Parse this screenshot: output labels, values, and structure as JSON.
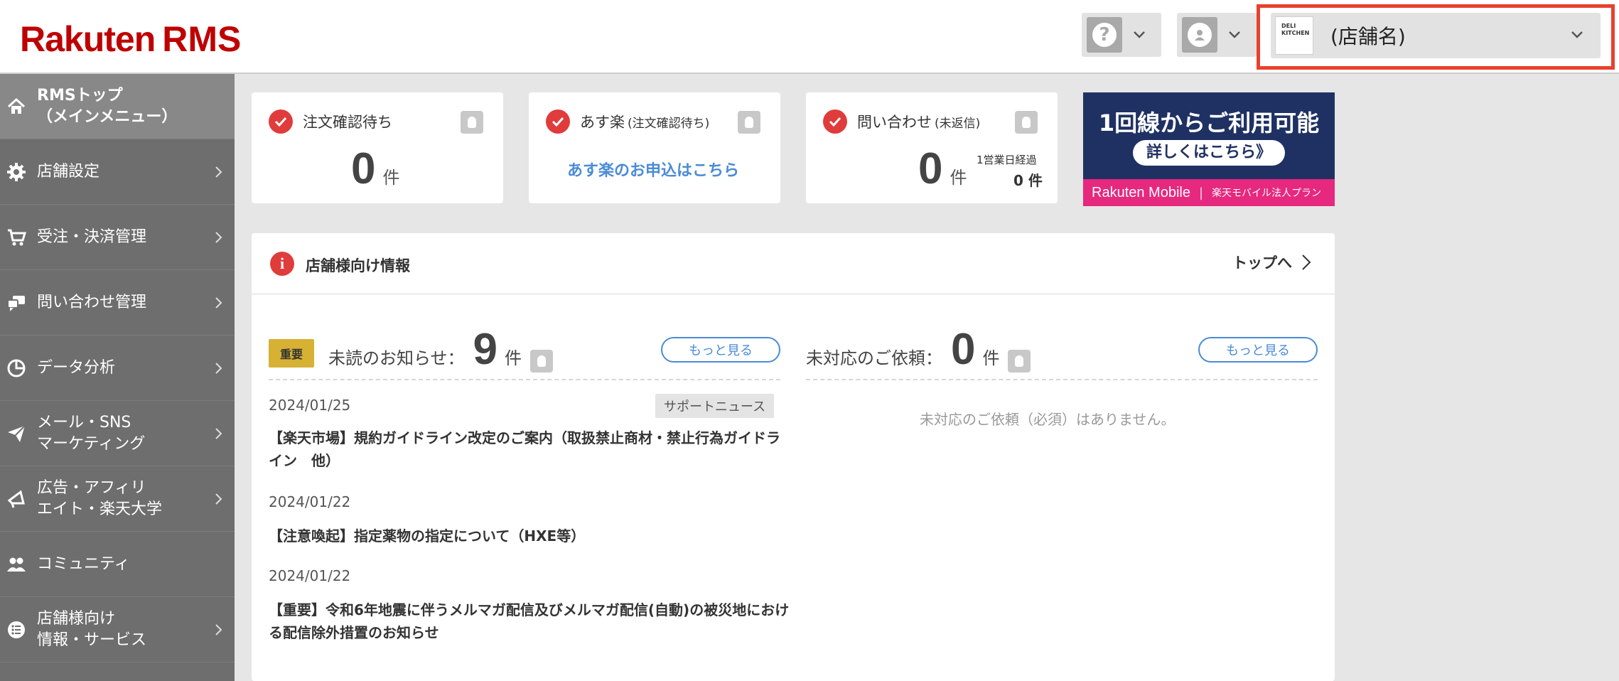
{
  "header": {
    "logo_brand": "Rakuten",
    "logo_product": "RMS",
    "store_logo_text": "DELI KITCHEN",
    "store_name": "(店舗名)",
    "highlight_color": "#e8412d"
  },
  "sidebar": {
    "items": [
      {
        "label": "RMSトップ\n（メインメニュー）",
        "icon": "home-icon",
        "active": true
      },
      {
        "label": "店舗設定",
        "icon": "gear-icon"
      },
      {
        "label": "受注・決済管理",
        "icon": "cart-icon"
      },
      {
        "label": "問い合わせ管理",
        "icon": "chat-icon"
      },
      {
        "label": "データ分析",
        "icon": "pie-chart-icon"
      },
      {
        "label": "メール・SNS\nマーケティング",
        "icon": "paper-plane-icon"
      },
      {
        "label": "広告・アフィリ\nエイト・楽天大学",
        "icon": "megaphone-icon"
      },
      {
        "label": "コミュニティ",
        "icon": "people-icon"
      },
      {
        "label": "店舗様向け\n情報・サービス",
        "icon": "list-icon"
      }
    ]
  },
  "cards": {
    "orders": {
      "title": "注文確認待ち",
      "count": "0",
      "unit": "件"
    },
    "asuraku": {
      "title": "あす楽",
      "title_small": "(注文確認待ち)",
      "link": "あす楽のお申込はこちら"
    },
    "inquiries": {
      "title": "問い合わせ",
      "title_small": "(未返信)",
      "count": "0",
      "unit": "件",
      "sub_label": "1営業日経過",
      "sub_value": "0 件"
    }
  },
  "banner": {
    "line1": "1回線からご利用可能",
    "button": "詳しくはこちら》",
    "brand": "Rakuten Mobile",
    "plan": "楽天モバイル法人プラン",
    "bg_color": "#1f3163",
    "strip_color": "#e6287e"
  },
  "info_panel": {
    "title": "店舗様向け情報",
    "top_link": "トップへ",
    "notices": {
      "badge": "重要",
      "label": "未読のお知らせ：",
      "count": "9",
      "unit": "件",
      "more": "もっと見る",
      "items": [
        {
          "date": "2024/01/25",
          "tag": "サポートニュース",
          "title": "【楽天市場】規約ガイドライン改定のご案内（取扱禁止商材・禁止行為ガイドライン　他）"
        },
        {
          "date": "2024/01/22",
          "tag": "",
          "title": "【注意喚起】指定薬物の指定について（HXE等）"
        },
        {
          "date": "2024/01/22",
          "tag": "",
          "title": "【重要】令和6年地震に伴うメルマガ配信及びメルマガ配信(自動)の被災地における配信除外措置のお知らせ"
        }
      ]
    },
    "requests": {
      "label": "未対応のご依頼：",
      "count": "0",
      "unit": "件",
      "more": "もっと見る",
      "empty": "未対応のご依頼（必須）はありません。"
    }
  }
}
